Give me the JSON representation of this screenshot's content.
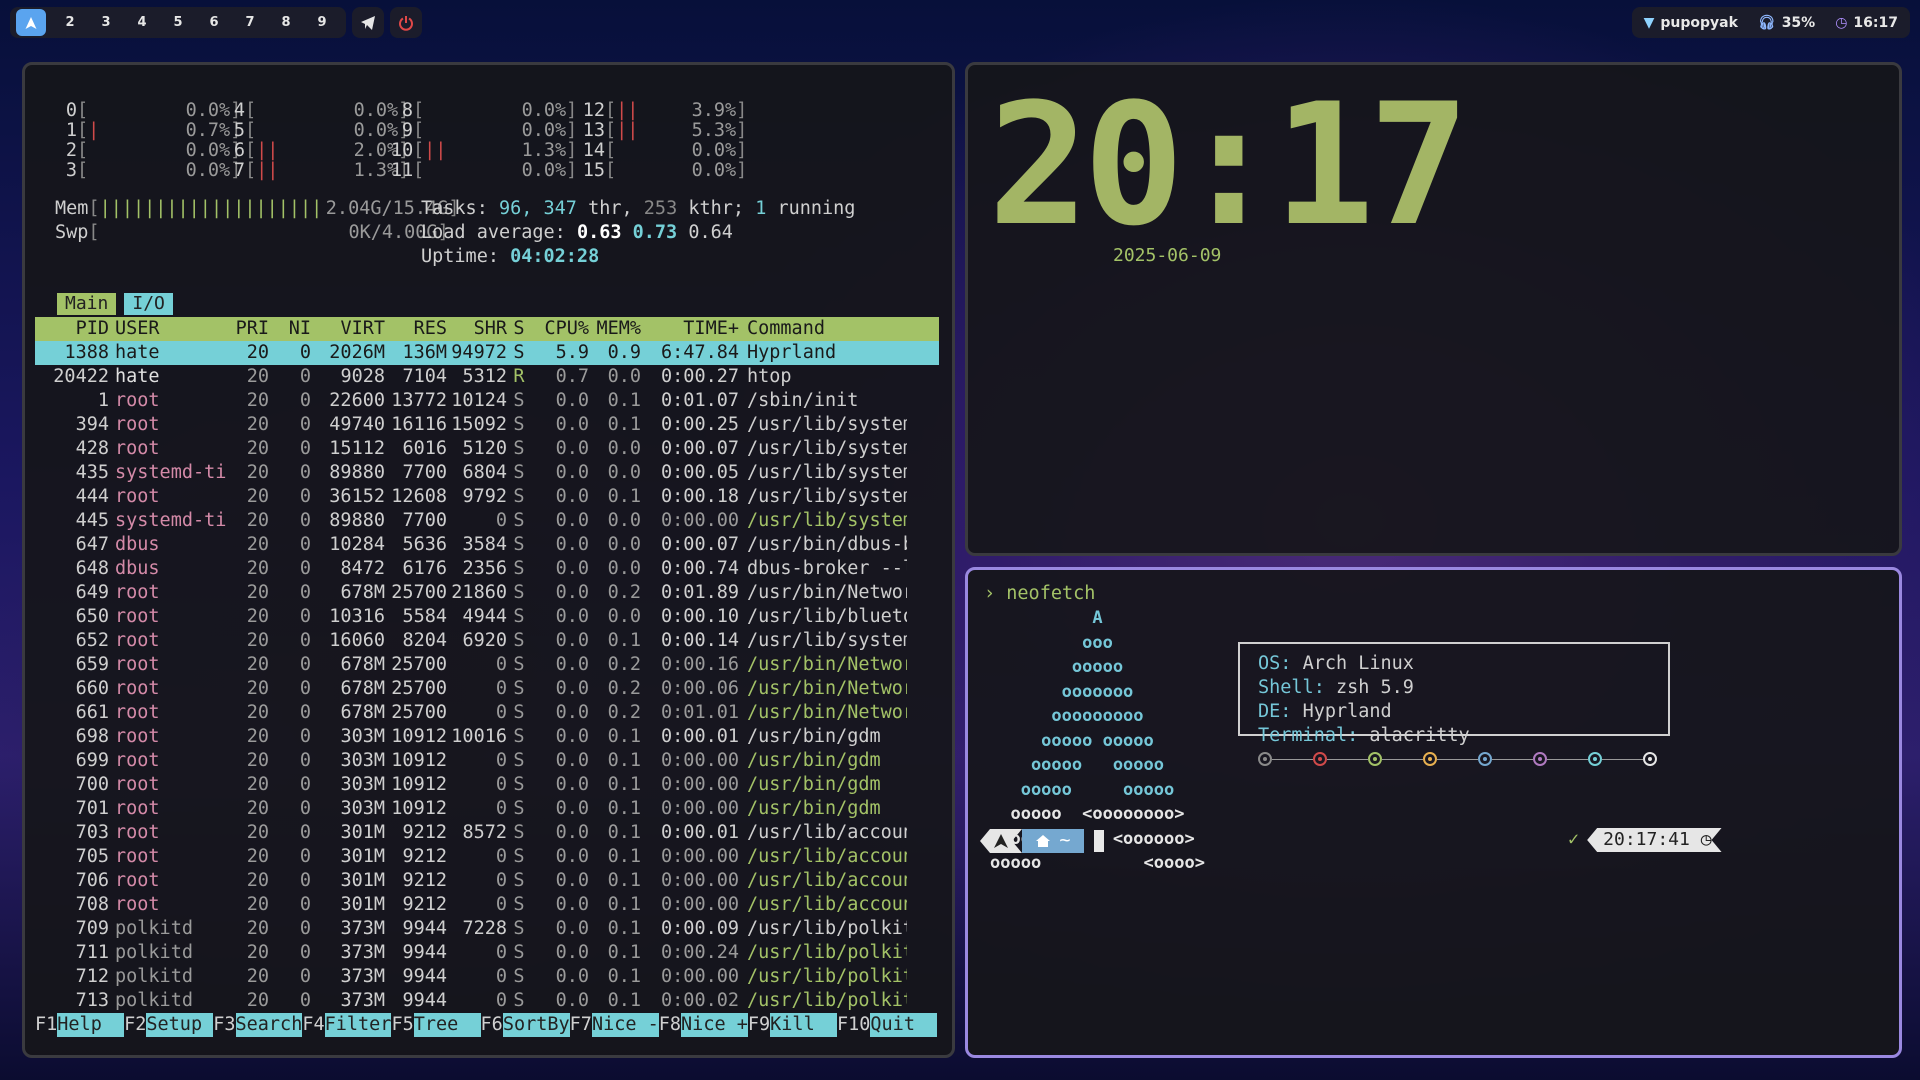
{
  "topbar": {
    "workspaces": [
      "2",
      "3",
      "4",
      "5",
      "6",
      "7",
      "8",
      "9"
    ],
    "active_workspace_icon": "arch-logo-icon",
    "tray": {
      "network_name": "pupopyak",
      "headphone_battery": "35%",
      "time": "16:17"
    }
  },
  "htop": {
    "cpus": [
      {
        "id": "0",
        "bar": "",
        "pct": "0.0%"
      },
      {
        "id": "1",
        "bar": "|",
        "pct": "0.7%"
      },
      {
        "id": "2",
        "bar": "",
        "pct": "0.0%"
      },
      {
        "id": "3",
        "bar": "",
        "pct": "0.0%"
      },
      {
        "id": "4",
        "bar": "",
        "pct": "0.0%"
      },
      {
        "id": "5",
        "bar": "",
        "pct": "0.0%"
      },
      {
        "id": "6",
        "bar": "||",
        "pct": "2.0%"
      },
      {
        "id": "7",
        "bar": "||",
        "pct": "1.3%"
      },
      {
        "id": "8",
        "bar": "",
        "pct": "0.0%"
      },
      {
        "id": "9",
        "bar": "",
        "pct": "0.0%"
      },
      {
        "id": "10",
        "bar": "||",
        "pct": "1.3%"
      },
      {
        "id": "11",
        "bar": "",
        "pct": "0.0%"
      },
      {
        "id": "12",
        "bar": "||",
        "pct": "3.9%"
      },
      {
        "id": "13",
        "bar": "||",
        "pct": "5.3%"
      },
      {
        "id": "14",
        "bar": "",
        "pct": "0.0%"
      },
      {
        "id": "15",
        "bar": "",
        "pct": "0.0%"
      }
    ],
    "mem_label": "Mem",
    "mem_bar": "||||||||||||||||||||",
    "mem_value": "2.04G/15.4G",
    "swp_label": "Swp",
    "swp_value": "0K/4.00G",
    "tasks_label": "Tasks:",
    "tasks_count": "96,",
    "thr_count": "347",
    "thr_label": "thr,",
    "kthr_count": "253",
    "kthr_label": "kthr;",
    "running_count": "1",
    "running_label": "running",
    "load_label": "Load average:",
    "load_1": "0.63",
    "load_5": "0.73",
    "load_15": "0.64",
    "uptime_label": "Uptime:",
    "uptime_value": "04:02:28",
    "tab_main": "Main",
    "tab_io": "I/O",
    "columns": [
      "PID",
      "USER",
      "PRI",
      "NI",
      "VIRT",
      "RES",
      "SHR",
      "S",
      "CPU%",
      "MEM%",
      "TIME+",
      "Command"
    ],
    "processes": [
      {
        "pid": "1388",
        "user": "hate",
        "pri": "20",
        "ni": "0",
        "virt": "2026M",
        "res": "136M",
        "shr": "94972",
        "s": "S",
        "cpu": "5.9",
        "mem": "0.9",
        "time": "6:47.84",
        "cmd": "Hyprland",
        "kind": "selected"
      },
      {
        "pid": "20422",
        "user": "hate",
        "pri": "20",
        "ni": "0",
        "virt": "9028",
        "res": "7104",
        "shr": "5312",
        "s": "R",
        "cpu": "0.7",
        "mem": "0.0",
        "time": "0:00.27",
        "cmd": "htop",
        "kind": "normal"
      },
      {
        "pid": "1",
        "user": "root",
        "pri": "20",
        "ni": "0",
        "virt": "22600",
        "res": "13772",
        "shr": "10124",
        "s": "S",
        "cpu": "0.0",
        "mem": "0.1",
        "time": "0:01.07",
        "cmd": "/sbin/init",
        "kind": "normal"
      },
      {
        "pid": "394",
        "user": "root",
        "pri": "20",
        "ni": "0",
        "virt": "49740",
        "res": "16116",
        "shr": "15092",
        "s": "S",
        "cpu": "0.0",
        "mem": "0.1",
        "time": "0:00.25",
        "cmd": "/usr/lib/system",
        "kind": "normal"
      },
      {
        "pid": "428",
        "user": "root",
        "pri": "20",
        "ni": "0",
        "virt": "15112",
        "res": "6016",
        "shr": "5120",
        "s": "S",
        "cpu": "0.0",
        "mem": "0.0",
        "time": "0:00.07",
        "cmd": "/usr/lib/system",
        "kind": "normal"
      },
      {
        "pid": "435",
        "user": "systemd-ti",
        "pri": "20",
        "ni": "0",
        "virt": "89880",
        "res": "7700",
        "shr": "6804",
        "s": "S",
        "cpu": "0.0",
        "mem": "0.0",
        "time": "0:00.05",
        "cmd": "/usr/lib/system",
        "kind": "normal"
      },
      {
        "pid": "444",
        "user": "root",
        "pri": "20",
        "ni": "0",
        "virt": "36152",
        "res": "12608",
        "shr": "9792",
        "s": "S",
        "cpu": "0.0",
        "mem": "0.1",
        "time": "0:00.18",
        "cmd": "/usr/lib/system",
        "kind": "normal"
      },
      {
        "pid": "445",
        "user": "systemd-ti",
        "pri": "20",
        "ni": "0",
        "virt": "89880",
        "res": "7700",
        "shr": "0",
        "s": "S",
        "cpu": "0.0",
        "mem": "0.0",
        "time": "0:00.00",
        "cmd": "/usr/lib/system",
        "kind": "thread"
      },
      {
        "pid": "647",
        "user": "dbus",
        "pri": "20",
        "ni": "0",
        "virt": "10284",
        "res": "5636",
        "shr": "3584",
        "s": "S",
        "cpu": "0.0",
        "mem": "0.0",
        "time": "0:00.07",
        "cmd": "/usr/bin/dbus-b",
        "kind": "normal"
      },
      {
        "pid": "648",
        "user": "dbus",
        "pri": "20",
        "ni": "0",
        "virt": "8472",
        "res": "6176",
        "shr": "2356",
        "s": "S",
        "cpu": "0.0",
        "mem": "0.0",
        "time": "0:00.74",
        "cmd": "dbus-broker --l",
        "kind": "normal"
      },
      {
        "pid": "649",
        "user": "root",
        "pri": "20",
        "ni": "0",
        "virt": "678M",
        "res": "25700",
        "shr": "21860",
        "s": "S",
        "cpu": "0.0",
        "mem": "0.2",
        "time": "0:01.89",
        "cmd": "/usr/bin/Networ",
        "kind": "normal"
      },
      {
        "pid": "650",
        "user": "root",
        "pri": "20",
        "ni": "0",
        "virt": "10316",
        "res": "5584",
        "shr": "4944",
        "s": "S",
        "cpu": "0.0",
        "mem": "0.0",
        "time": "0:00.10",
        "cmd": "/usr/lib/blueto",
        "kind": "normal"
      },
      {
        "pid": "652",
        "user": "root",
        "pri": "20",
        "ni": "0",
        "virt": "16060",
        "res": "8204",
        "shr": "6920",
        "s": "S",
        "cpu": "0.0",
        "mem": "0.1",
        "time": "0:00.14",
        "cmd": "/usr/lib/system",
        "kind": "normal"
      },
      {
        "pid": "659",
        "user": "root",
        "pri": "20",
        "ni": "0",
        "virt": "678M",
        "res": "25700",
        "shr": "0",
        "s": "S",
        "cpu": "0.0",
        "mem": "0.2",
        "time": "0:00.16",
        "cmd": "/usr/bin/Networ",
        "kind": "thread"
      },
      {
        "pid": "660",
        "user": "root",
        "pri": "20",
        "ni": "0",
        "virt": "678M",
        "res": "25700",
        "shr": "0",
        "s": "S",
        "cpu": "0.0",
        "mem": "0.2",
        "time": "0:00.06",
        "cmd": "/usr/bin/Networ",
        "kind": "thread"
      },
      {
        "pid": "661",
        "user": "root",
        "pri": "20",
        "ni": "0",
        "virt": "678M",
        "res": "25700",
        "shr": "0",
        "s": "S",
        "cpu": "0.0",
        "mem": "0.2",
        "time": "0:01.01",
        "cmd": "/usr/bin/Networ",
        "kind": "thread"
      },
      {
        "pid": "698",
        "user": "root",
        "pri": "20",
        "ni": "0",
        "virt": "303M",
        "res": "10912",
        "shr": "10016",
        "s": "S",
        "cpu": "0.0",
        "mem": "0.1",
        "time": "0:00.01",
        "cmd": "/usr/bin/gdm",
        "kind": "normal"
      },
      {
        "pid": "699",
        "user": "root",
        "pri": "20",
        "ni": "0",
        "virt": "303M",
        "res": "10912",
        "shr": "0",
        "s": "S",
        "cpu": "0.0",
        "mem": "0.1",
        "time": "0:00.00",
        "cmd": "/usr/bin/gdm",
        "kind": "thread"
      },
      {
        "pid": "700",
        "user": "root",
        "pri": "20",
        "ni": "0",
        "virt": "303M",
        "res": "10912",
        "shr": "0",
        "s": "S",
        "cpu": "0.0",
        "mem": "0.1",
        "time": "0:00.00",
        "cmd": "/usr/bin/gdm",
        "kind": "thread"
      },
      {
        "pid": "701",
        "user": "root",
        "pri": "20",
        "ni": "0",
        "virt": "303M",
        "res": "10912",
        "shr": "0",
        "s": "S",
        "cpu": "0.0",
        "mem": "0.1",
        "time": "0:00.00",
        "cmd": "/usr/bin/gdm",
        "kind": "thread"
      },
      {
        "pid": "703",
        "user": "root",
        "pri": "20",
        "ni": "0",
        "virt": "301M",
        "res": "9212",
        "shr": "8572",
        "s": "S",
        "cpu": "0.0",
        "mem": "0.1",
        "time": "0:00.01",
        "cmd": "/usr/lib/accoun",
        "kind": "normal"
      },
      {
        "pid": "705",
        "user": "root",
        "pri": "20",
        "ni": "0",
        "virt": "301M",
        "res": "9212",
        "shr": "0",
        "s": "S",
        "cpu": "0.0",
        "mem": "0.1",
        "time": "0:00.00",
        "cmd": "/usr/lib/accoun",
        "kind": "thread"
      },
      {
        "pid": "706",
        "user": "root",
        "pri": "20",
        "ni": "0",
        "virt": "301M",
        "res": "9212",
        "shr": "0",
        "s": "S",
        "cpu": "0.0",
        "mem": "0.1",
        "time": "0:00.00",
        "cmd": "/usr/lib/accoun",
        "kind": "thread"
      },
      {
        "pid": "708",
        "user": "root",
        "pri": "20",
        "ni": "0",
        "virt": "301M",
        "res": "9212",
        "shr": "0",
        "s": "S",
        "cpu": "0.0",
        "mem": "0.1",
        "time": "0:00.00",
        "cmd": "/usr/lib/accoun",
        "kind": "thread"
      },
      {
        "pid": "709",
        "user": "polkitd",
        "pri": "20",
        "ni": "0",
        "virt": "373M",
        "res": "9944",
        "shr": "7228",
        "s": "S",
        "cpu": "0.0",
        "mem": "0.1",
        "time": "0:00.09",
        "cmd": "/usr/lib/polkit",
        "kind": "normal"
      },
      {
        "pid": "711",
        "user": "polkitd",
        "pri": "20",
        "ni": "0",
        "virt": "373M",
        "res": "9944",
        "shr": "0",
        "s": "S",
        "cpu": "0.0",
        "mem": "0.1",
        "time": "0:00.24",
        "cmd": "/usr/lib/polkit",
        "kind": "thread"
      },
      {
        "pid": "712",
        "user": "polkitd",
        "pri": "20",
        "ni": "0",
        "virt": "373M",
        "res": "9944",
        "shr": "0",
        "s": "S",
        "cpu": "0.0",
        "mem": "0.1",
        "time": "0:00.00",
        "cmd": "/usr/lib/polkit",
        "kind": "thread"
      },
      {
        "pid": "713",
        "user": "polkitd",
        "pri": "20",
        "ni": "0",
        "virt": "373M",
        "res": "9944",
        "shr": "0",
        "s": "S",
        "cpu": "0.0",
        "mem": "0.1",
        "time": "0:00.02",
        "cmd": "/usr/lib/polkit",
        "kind": "thread"
      }
    ],
    "fkeys": [
      {
        "key": "F1",
        "label": "Help  "
      },
      {
        "key": "F2",
        "label": "Setup "
      },
      {
        "key": "F3",
        "label": "Search"
      },
      {
        "key": "F4",
        "label": "Filter"
      },
      {
        "key": "F5",
        "label": "Tree  "
      },
      {
        "key": "F6",
        "label": "SortBy"
      },
      {
        "key": "F7",
        "label": "Nice -"
      },
      {
        "key": "F8",
        "label": "Nice +"
      },
      {
        "key": "F9",
        "label": "Kill  "
      },
      {
        "key": "F10",
        "label": "Quit  "
      }
    ]
  },
  "clock": {
    "time": "20:17",
    "date": "2025-06-09"
  },
  "terminal": {
    "prompt_symbol": "›",
    "command": "neofetch",
    "logo_lines": [
      "          A",
      "         ooo",
      "        ooooo",
      "       ooooooo",
      "      ooooooooo",
      "     ooooo ooooo",
      "    ooooo   ooooo",
      "   ooooo     ooooo",
      "  ooooo  <oooooooo>",
      " ooooo      <oooooo>",
      "ooooo          <oooo>"
    ],
    "info": [
      {
        "key": "OS:",
        "value": "Arch Linux"
      },
      {
        "key": "Shell:",
        "value": "zsh 5.9"
      },
      {
        "key": "DE:",
        "value": "Hyprland"
      },
      {
        "key": "Terminal:",
        "value": "alacritty"
      }
    ],
    "palette_colors": [
      "#8a8a8a",
      "#d04a4a",
      "#a3c267",
      "#e8b050",
      "#75a8d0",
      "#b07ac0",
      "#75d0d7",
      "#e6e6e6"
    ],
    "path_home": "~",
    "check_mark": "✓",
    "right_time": "20:17:41"
  }
}
